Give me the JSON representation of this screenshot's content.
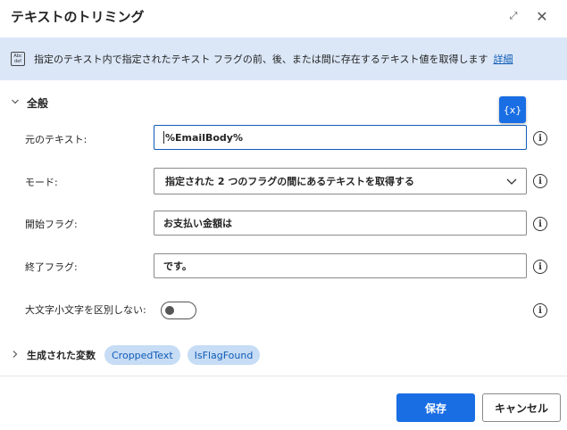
{
  "window": {
    "title": "テキストのトリミング",
    "expand_glyph": "⤢",
    "close_glyph": "✕"
  },
  "banner": {
    "icon_lines": [
      "Abc",
      "def"
    ],
    "description": "指定のテキスト内で指定されたテキスト フラグの前、後、または間に存在するテキスト値を取得します",
    "link": "詳細"
  },
  "general": {
    "header": "全般",
    "var_button": "{x}",
    "fields": {
      "original_text": {
        "label": "元のテキスト:",
        "value": "%EmailBody%"
      },
      "mode": {
        "label": "モード:",
        "value": "指定された 2 つのフラグの間にあるテキストを取得する"
      },
      "start_flag": {
        "label": "開始フラグ:",
        "value": "お支払い金額は"
      },
      "end_flag": {
        "label": "終了フラグ:",
        "value": "です。"
      },
      "ignore_case": {
        "label": "大文字小文字を区別しない:",
        "enabled": false
      }
    },
    "info_glyph": "i"
  },
  "outputs": {
    "header": "生成された変数",
    "variables": [
      "CroppedText",
      "IsFlagFound"
    ]
  },
  "footer": {
    "save": "保存",
    "cancel": "キャンセル"
  },
  "colors": {
    "accent": "#1a6ee4",
    "banner_bg": "#dbe7f7",
    "chip_bg": "#c7dcf5",
    "link": "#0f5cb5"
  },
  "icons": [
    "expand-icon",
    "close-icon",
    "text-doc-icon",
    "chevron-down-icon",
    "chevron-right-icon",
    "info-icon",
    "variable-icon"
  ]
}
